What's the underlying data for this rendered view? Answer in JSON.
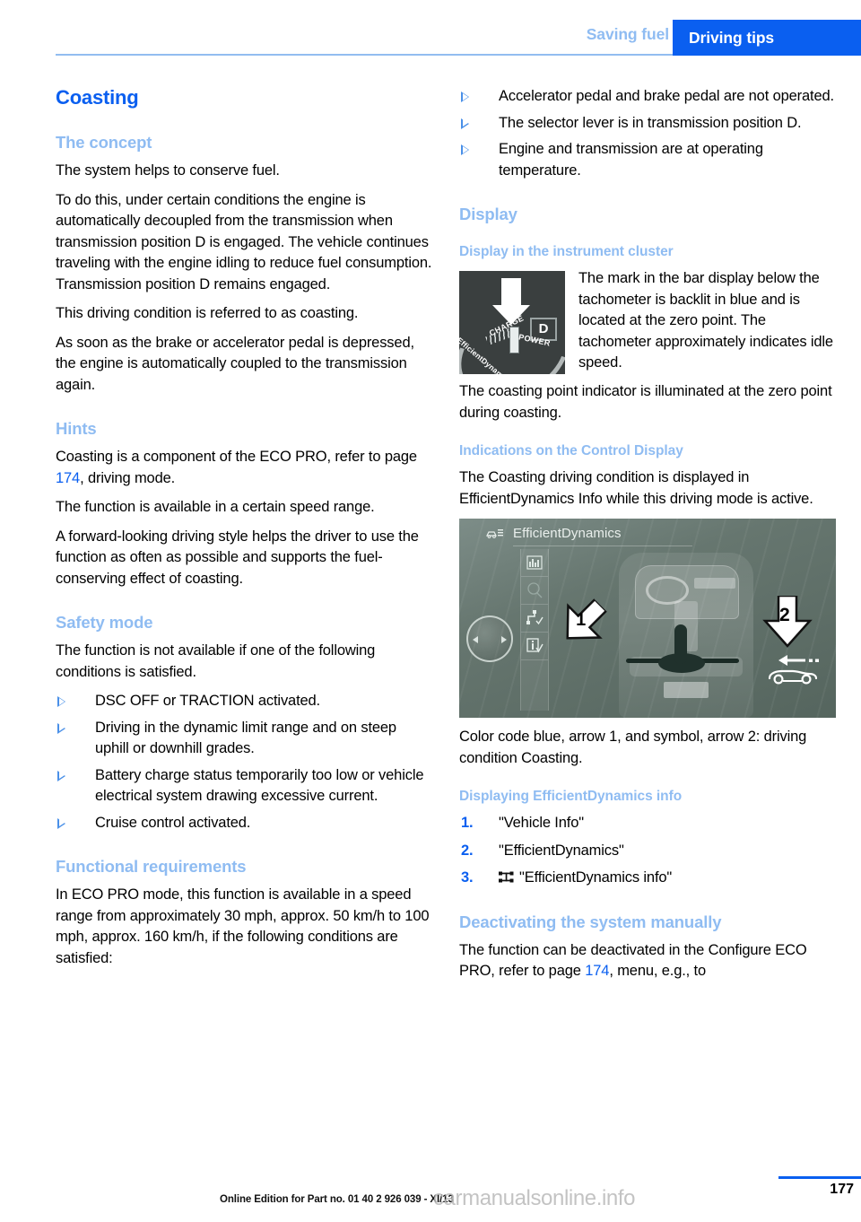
{
  "header": {
    "chapter": "Saving fuel",
    "section_tab": "Driving tips",
    "accent_blue": "#0a5ff0",
    "light_blue": "#8fbcf2"
  },
  "left_column": {
    "title": "Coasting",
    "sections": [
      {
        "heading": "The concept",
        "paragraphs": [
          "The system helps to conserve fuel.",
          "To do this, under certain conditions the engine is automatically decoupled from the transmission when transmission position D is engaged. The vehicle continues traveling with the engine idling to reduce fuel consumption. Transmission position D remains engaged.",
          "This driving condition is referred to as coasting.",
          "As soon as the brake or accelerator pedal is depressed, the engine is automatically coupled to the transmission again."
        ]
      },
      {
        "heading": "Hints",
        "para_ref_pre": "Coasting is a component of the ECO PRO, refer to page ",
        "para_ref_num": "174",
        "para_ref_post": ", driving mode.",
        "paragraphs": [
          "The function is available in a certain speed range.",
          "A forward-looking driving style helps the driver to use the function as often as possible and supports the fuel-conserving effect of coasting."
        ]
      },
      {
        "heading": "Safety mode",
        "intro": "The function is not available if one of the following conditions is satisfied.",
        "bullets": [
          "DSC OFF or TRACTION activated.",
          "Driving in the dynamic limit range and on steep uphill or downhill grades.",
          "Battery charge status temporarily too low or vehicle electrical system drawing excessive current.",
          "Cruise control activated."
        ]
      },
      {
        "heading": "Functional requirements",
        "paragraphs": [
          "In ECO PRO mode, this function is available in a speed range from approximately 30 mph, approx. 50 km/h to 100 mph, approx. 160 km/h, if the following conditions are satisfied:"
        ]
      }
    ]
  },
  "right_column": {
    "continued_bullets": [
      "Accelerator pedal and brake pedal are not operated.",
      "The selector lever is in transmission position D.",
      "Engine and transmission are at operating temperature."
    ],
    "display_heading": "Display",
    "cluster": {
      "subheading": "Display in the instrument cluster",
      "image": {
        "name": "instrument-cluster-coasting-point",
        "d_label": "D",
        "charge_label": "CHARGE",
        "power_label": "POWER",
        "efficient_label": "EfficientDynamics",
        "background": "#3a3f3f"
      },
      "caption": "The mark in the bar display below the tachometer is backlit in blue and is located at the zero point. The tachometer approximately indicates idle speed.",
      "after_text": "The coasting point indicator is illuminated at the zero point during coasting."
    },
    "control_display": {
      "subheading": "Indications on the Control Display",
      "intro": "The Coasting driving condition is displayed in EfficientDynamics Info while this driving mode is active.",
      "image": {
        "name": "control-display-efficientdynamics",
        "screen_title": "EfficientDynamics",
        "arrow1_label": "1",
        "arrow2_label": "2",
        "menu_icons": [
          "bar-chart-icon",
          "magnifier-icon",
          "route-check-icon",
          "info-check-icon"
        ],
        "background": "#66766f"
      },
      "caption": "Color code blue, arrow 1, and symbol, arrow 2: driving condition Coasting."
    },
    "displaying_info": {
      "subheading": "Displaying EfficientDynamics info",
      "steps": [
        {
          "num": "1.",
          "text": "\"Vehicle Info\"",
          "icon": null
        },
        {
          "num": "2.",
          "text": "\"EfficientDynamics\"",
          "icon": null
        },
        {
          "num": "3.",
          "text": "\"EfficientDynamics info\"",
          "icon": "vehicle-axle-icon"
        }
      ]
    },
    "deactivating": {
      "subheading": "Deactivating the system manually",
      "text_pre": "The function can be deactivated in the Configure ECO PRO, refer to page ",
      "ref_num": "174",
      "text_post": ", menu, e.g., to"
    }
  },
  "footer": {
    "edition": "Online Edition for Part no. 01 40 2 926 039 - XI/13",
    "page_number": "177",
    "watermark": "carmanualsonline.info"
  }
}
